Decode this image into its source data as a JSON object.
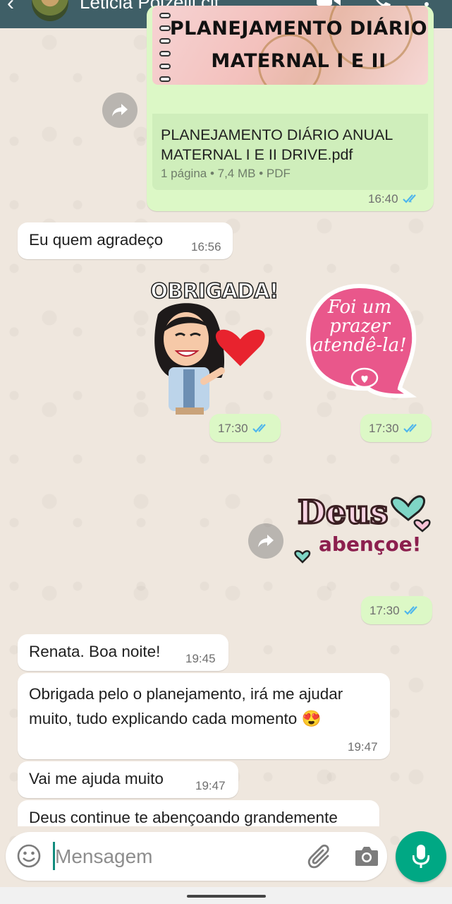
{
  "header": {
    "contact_name": "Leticia Polzelli cit",
    "icons": [
      "back-arrow-icon",
      "avatar",
      "video-call-icon",
      "voice-call-icon",
      "more-options-icon"
    ]
  },
  "messages": {
    "document": {
      "thumbnail_line1": "PLANEJAMENTO DIÁRIO",
      "thumbnail_line2": "MATERNAL I E II",
      "file_name_line1": "PLANEJAMENTO DIÁRIO ANUAL",
      "file_name_line2": "MATERNAL I E II DRIVE.pdf",
      "details": "1 página • 7,4 MB • PDF",
      "time": "16:40"
    },
    "thanks_reply": {
      "text": "Eu quem agradeço",
      "time": "16:56"
    },
    "sticker_obrigada": {
      "text": "OBRIGADA!",
      "time": "17:30"
    },
    "sticker_foium": {
      "line1": "Foi um",
      "line2": "prazer",
      "line3": "atendê-la!",
      "time": "17:30"
    },
    "sticker_deus": {
      "line1": "Deus",
      "line2": "abençoe!",
      "time": "17:30"
    },
    "greeting": {
      "text": "Renata. Boa noite!",
      "time": "19:45"
    },
    "feedback": {
      "line1": "Obrigada pelo o planejamento, irá me ajudar",
      "line2": "muito, tudo explicando cada momento 😍",
      "time": "19:47"
    },
    "help": {
      "text": "Vai me ajuda muito",
      "time": "19:47"
    },
    "blessing": {
      "text": "Deus continue te abençoando grandemente"
    }
  },
  "composer": {
    "placeholder": "Mensagem",
    "icons": [
      "emoji-icon",
      "attach-icon",
      "camera-icon",
      "mic-icon"
    ]
  },
  "colors": {
    "header": "#3f5f67",
    "incoming_bubble": "#ffffff",
    "outgoing_bubble": "#dcf8c6",
    "read_ticks": "#4fb6ec",
    "mic_button": "#00a884"
  }
}
